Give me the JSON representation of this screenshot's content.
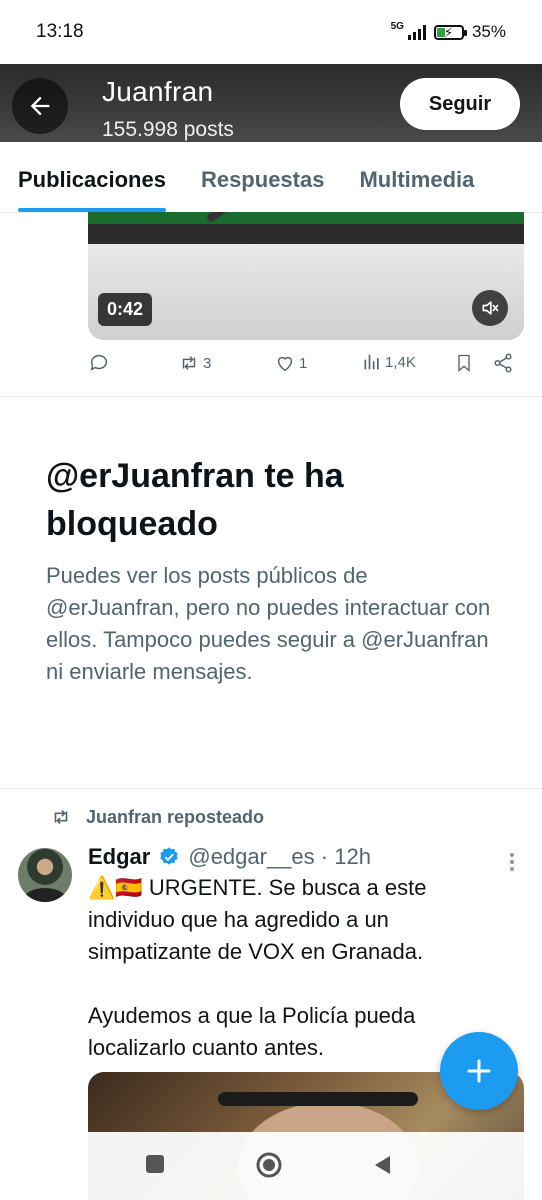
{
  "status_bar": {
    "time": "13:18",
    "network": "5G",
    "battery_percent": "35%",
    "battery_level": 0.35
  },
  "header": {
    "title": "Juanfran",
    "posts_count": "155.998 posts",
    "follow_label": "Seguir"
  },
  "tabs": [
    {
      "label": "Publicaciones",
      "active": true
    },
    {
      "label": "Respuestas",
      "active": false
    },
    {
      "label": "Multimedia",
      "active": false
    }
  ],
  "video_post": {
    "duration": "0:42",
    "actions": {
      "replies": "",
      "reposts": "3",
      "likes": "1",
      "views": "1,4K"
    }
  },
  "blocked_notice": {
    "title": "@erJuanfran te ha bloqueado",
    "description": "Puedes ver los posts públicos de @erJuanfran, pero no puedes interactuar con ellos. Tampoco puedes seguir a @erJuanfran ni enviarle mensajes."
  },
  "retweet": {
    "label": "Juanfran reposteado",
    "author_name": "Edgar",
    "handle_time": "@edgar__es · 12h",
    "text": "⚠️🇪🇸 URGENTE. Se busca a este individuo que ha agredido a un simpatizante de VOX en Granada.\n\nAyudemos a que la Policía pueda localizarlo cuanto antes."
  },
  "colors": {
    "accent": "#1d9bf0",
    "text_primary": "#0f1419",
    "text_secondary": "#536471",
    "verified": "#1d9bf0"
  },
  "icons": {
    "back": "arrow-left-icon",
    "mute": "speaker-muted-icon",
    "reply": "chat-bubble-icon",
    "repost": "repost-icon",
    "like": "heart-icon",
    "views": "bar-chart-icon",
    "bookmark": "bookmark-icon",
    "share": "share-icon",
    "verified": "verified-badge-icon",
    "more": "more-vertical-icon",
    "compose": "plus-icon",
    "nav_recents": "square-icon",
    "nav_home": "circle-icon",
    "nav_back": "triangle-back-icon"
  }
}
